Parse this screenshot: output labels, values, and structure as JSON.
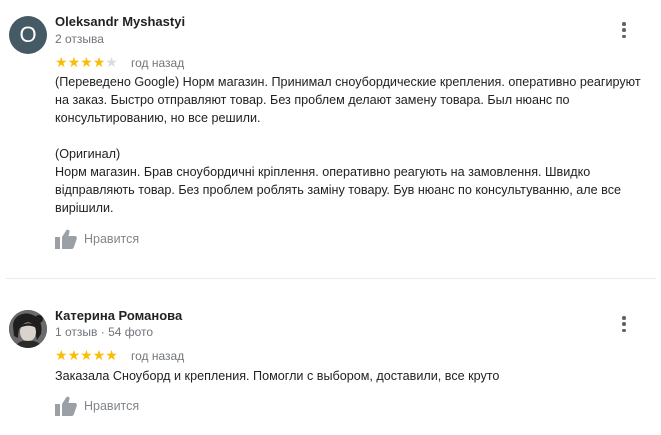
{
  "reviews": [
    {
      "avatar_letter": "O",
      "avatar_color": "#455a64",
      "name": "Oleksandr Myshastyi",
      "meta": "2 отзыва",
      "rating": 4,
      "date": "год назад",
      "text_translated": "(Переведено Google) Норм магазин. Принимал сноубордические крепления. оперативно реагируют на заказ. Быстро отправляют товар. Без проблем делают замену товара. Был нюанс по консультированию, но все решили.",
      "original_label": "(Оригинал)",
      "text_original": "Норм магазин. Брав сноубордичні кріплення. оперативно реагують на замовлення. Швидко відправляють товар. Без проблем роблять заміну товару. Був  нюанс по консультуванню, але все вирішили.",
      "like_label": "Нравится"
    },
    {
      "avatar_icon": "profile-photo",
      "name": "Катерина Романова",
      "meta": "1 отзыв · 54 фото",
      "rating": 5,
      "date": "год назад",
      "text": "Заказала Сноуборд и крепления. Помогли с выбором, доставили, все круто",
      "like_label": "Нравится"
    }
  ],
  "colors": {
    "star": "#fbbc04",
    "star_empty": "#dadce0",
    "secondary_text": "#70757a"
  }
}
